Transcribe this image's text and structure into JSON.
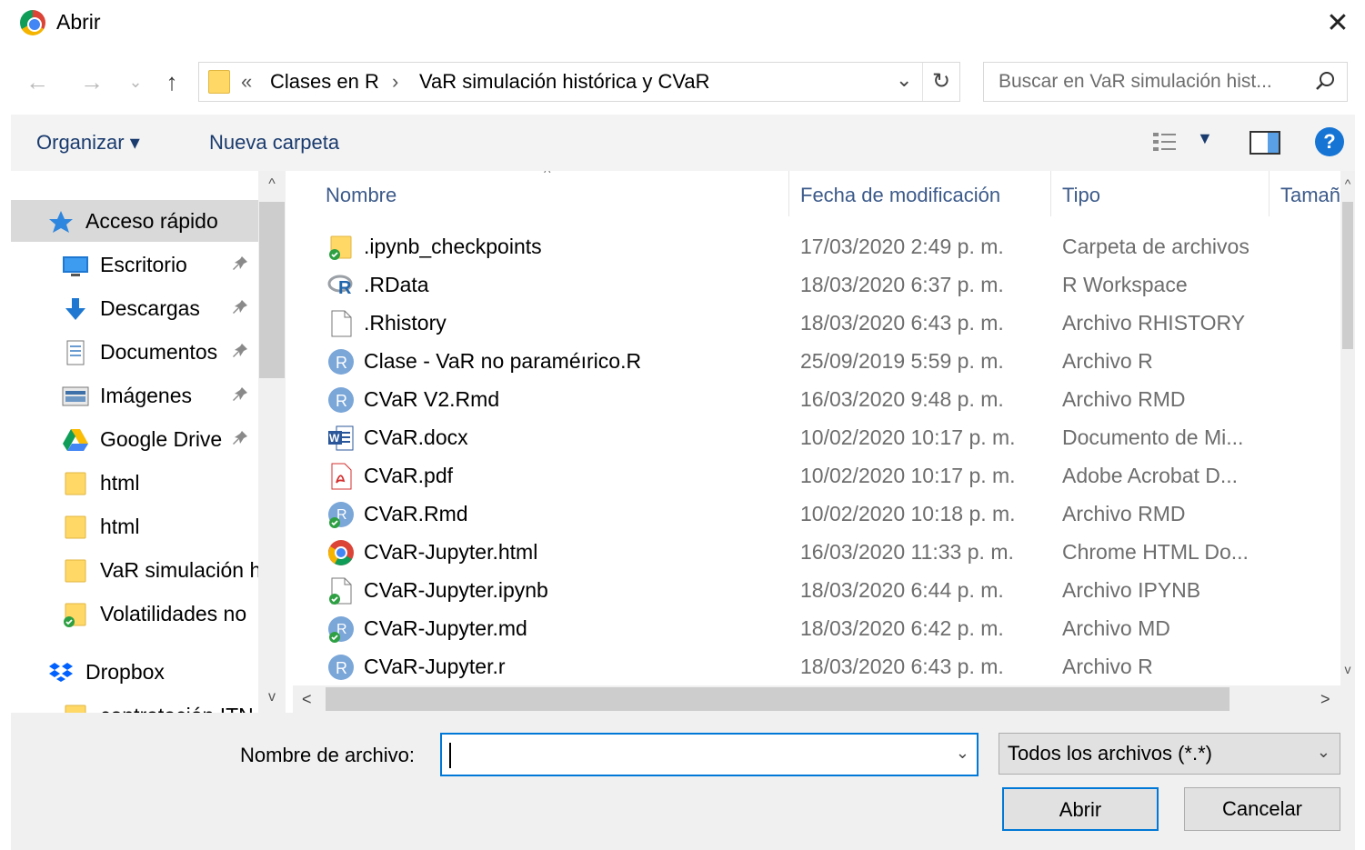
{
  "window": {
    "title": "Abrir",
    "close_glyph": "✕"
  },
  "nav": {
    "back_glyph": "←",
    "forward_glyph": "→",
    "recent_glyph": "⌄",
    "up_glyph": "↑",
    "breadcrumb_overflow": "«",
    "breadcrumb": [
      "Clases en R",
      "VaR simulación histórica y CVaR"
    ],
    "breadcrumb_sep": "›",
    "address_dropdown": "⌄",
    "refresh_glyph": "↻"
  },
  "search": {
    "placeholder": "Buscar en VaR simulación hist..."
  },
  "toolbar": {
    "organize": "Organizar ▾",
    "new_folder": "Nueva carpeta",
    "view_dropdown": "▼",
    "help": "?"
  },
  "sidebar": {
    "items": [
      {
        "label": "Acceso rápido",
        "icon": "star-icon",
        "pinned": false,
        "selected": true
      },
      {
        "label": "Escritorio",
        "icon": "desktop-icon",
        "pinned": true
      },
      {
        "label": "Descargas",
        "icon": "download-icon",
        "pinned": true
      },
      {
        "label": "Documentos",
        "icon": "documents-icon",
        "pinned": true
      },
      {
        "label": "Imágenes",
        "icon": "pictures-icon",
        "pinned": true
      },
      {
        "label": "Google Drive",
        "icon": "google-drive-icon",
        "pinned": true
      },
      {
        "label": "html",
        "icon": "folder-icon",
        "pinned": false
      },
      {
        "label": "html",
        "icon": "folder-icon",
        "pinned": false
      },
      {
        "label": "VaR simulación h",
        "icon": "folder-icon",
        "pinned": false
      },
      {
        "label": "Volatilidades no",
        "icon": "folder-sync-icon",
        "pinned": false
      },
      {
        "label": "Dropbox",
        "icon": "dropbox-icon",
        "pinned": false
      },
      {
        "label": "contratación ITN",
        "icon": "folder-icon",
        "pinned": false
      }
    ],
    "pin_glyph": "📌"
  },
  "columns": {
    "name": "Nombre",
    "date": "Fecha de modificación",
    "type": "Tipo",
    "size": "Tamañ"
  },
  "files": [
    {
      "name": ".ipynb_checkpoints",
      "date": "17/03/2020 2:49 p. m.",
      "type": "Carpeta de archivos",
      "icon": "folder-sync-icon"
    },
    {
      "name": ".RData",
      "date": "18/03/2020 6:37 p. m.",
      "type": "R Workspace",
      "icon": "r-workspace-icon"
    },
    {
      "name": ".Rhistory",
      "date": "18/03/2020 6:43 p. m.",
      "type": "Archivo RHISTORY",
      "icon": "blank-file-icon"
    },
    {
      "name": "Clase - VaR no paraméırico.R",
      "date": "25/09/2019 5:59 p. m.",
      "type": "Archivo R",
      "icon": "r-file-icon"
    },
    {
      "name": "CVaR V2.Rmd",
      "date": "16/03/2020 9:48 p. m.",
      "type": "Archivo RMD",
      "icon": "r-file-icon"
    },
    {
      "name": "CVaR.docx",
      "date": "10/02/2020 10:17 p. m.",
      "type": "Documento de Mi...",
      "icon": "word-icon"
    },
    {
      "name": "CVaR.pdf",
      "date": "10/02/2020 10:17 p. m.",
      "type": "Adobe Acrobat D...",
      "icon": "pdf-icon"
    },
    {
      "name": "CVaR.Rmd",
      "date": "10/02/2020 10:18 p. m.",
      "type": "Archivo RMD",
      "icon": "r-file-sync-icon"
    },
    {
      "name": "CVaR-Jupyter.html",
      "date": "16/03/2020 11:33 p. m.",
      "type": "Chrome HTML Do...",
      "icon": "chrome-icon"
    },
    {
      "name": "CVaR-Jupyter.ipynb",
      "date": "18/03/2020 6:44 p. m.",
      "type": "Archivo IPYNB",
      "icon": "blank-file-sync-icon"
    },
    {
      "name": "CVaR-Jupyter.md",
      "date": "18/03/2020 6:42 p. m.",
      "type": "Archivo MD",
      "icon": "r-file-sync-icon"
    },
    {
      "name": "CVaR-Jupyter.r",
      "date": "18/03/2020 6:43 p. m.",
      "type": "Archivo R",
      "icon": "r-file-icon"
    }
  ],
  "scroll": {
    "up": "^",
    "down": "v",
    "left": "<",
    "right": ">",
    "sort_caret": "^"
  },
  "footer": {
    "filename_label": "Nombre de archivo:",
    "filename_value": "",
    "filename_dropdown": "⌄",
    "filter_value": "Todos los archivos (*.*)",
    "filter_dropdown": "⌄",
    "open_button": "Abrir",
    "cancel_button": "Cancelar"
  }
}
